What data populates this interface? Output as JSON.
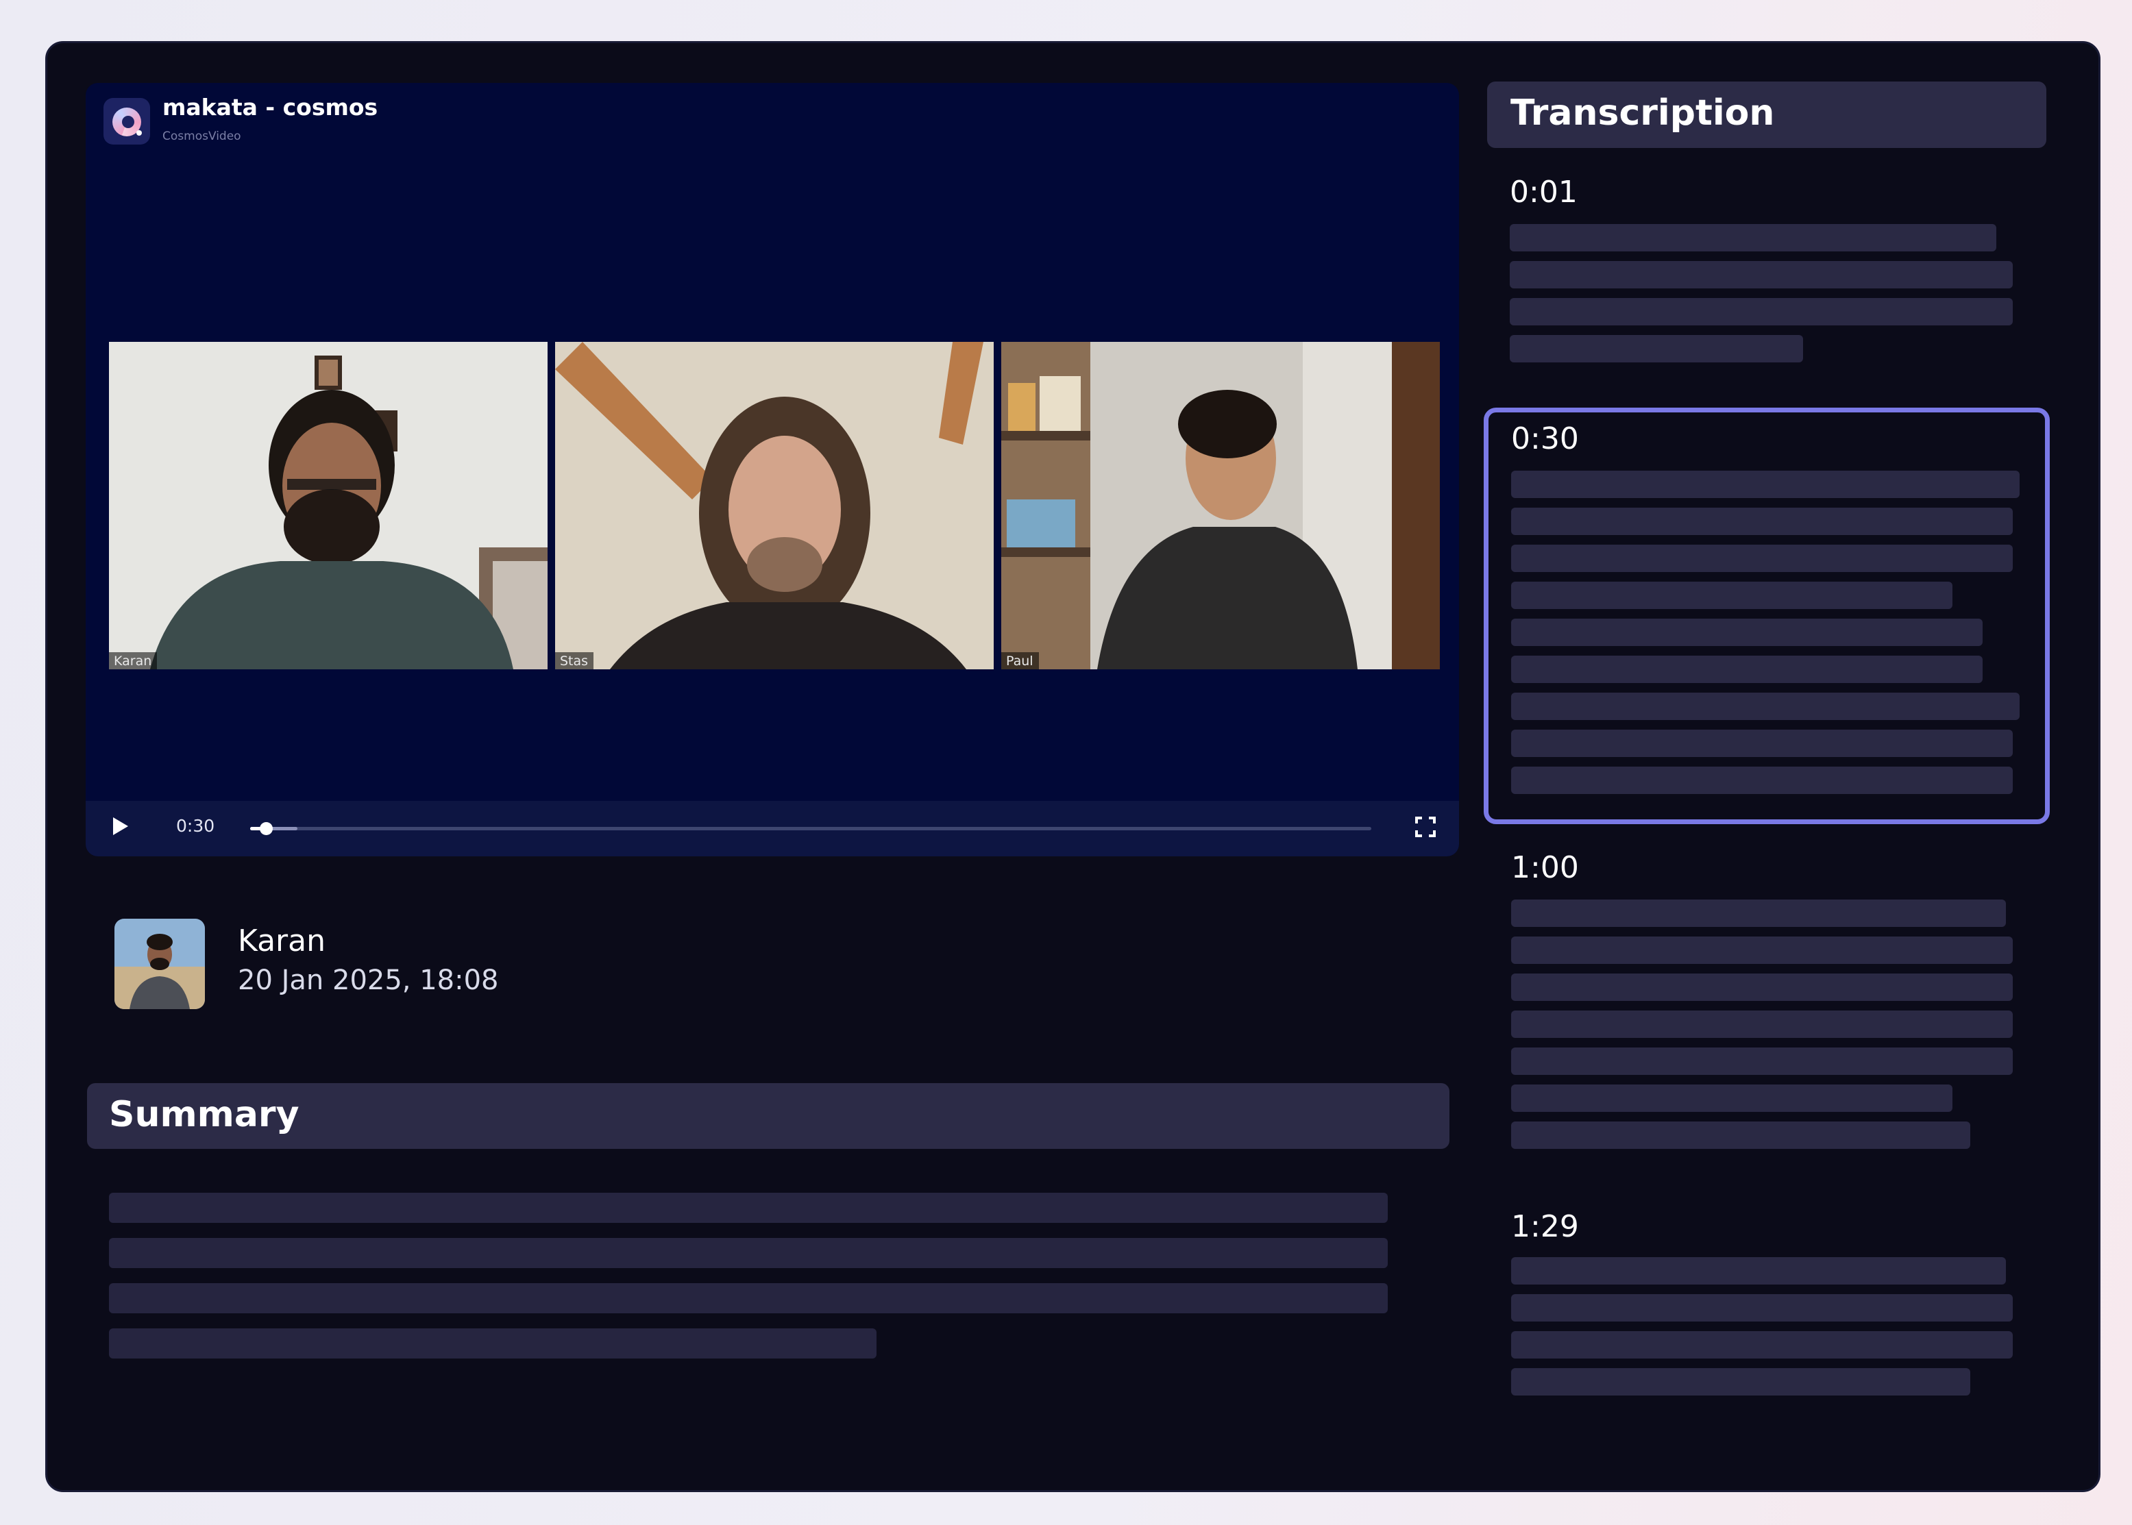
{
  "player": {
    "brand_title": "makata - cosmos",
    "brand_subtitle": "CosmosVideo",
    "participants": [
      {
        "label": "Karan"
      },
      {
        "label": "Stas"
      },
      {
        "label": "Paul"
      }
    ],
    "current_time": "0:30",
    "progress_fraction": 0.014
  },
  "author": {
    "name": "Karan",
    "date": "20 Jan 2025, 18:08"
  },
  "summary": {
    "title": "Summary"
  },
  "transcription": {
    "title": "Transcription",
    "segments": [
      {
        "time": "0:01",
        "active": false
      },
      {
        "time": "0:30",
        "active": true
      },
      {
        "time": "1:00",
        "active": false
      },
      {
        "time": "1:29",
        "active": false
      }
    ]
  },
  "colors": {
    "window_bg": "#0b0b19",
    "player_bg": "#010837",
    "header_bg": "#2c2b47",
    "accent": "#7a79e6",
    "placeholder": "#2a2944"
  },
  "icons": [
    "app-logo-icon",
    "play-icon",
    "fullscreen-icon"
  ]
}
